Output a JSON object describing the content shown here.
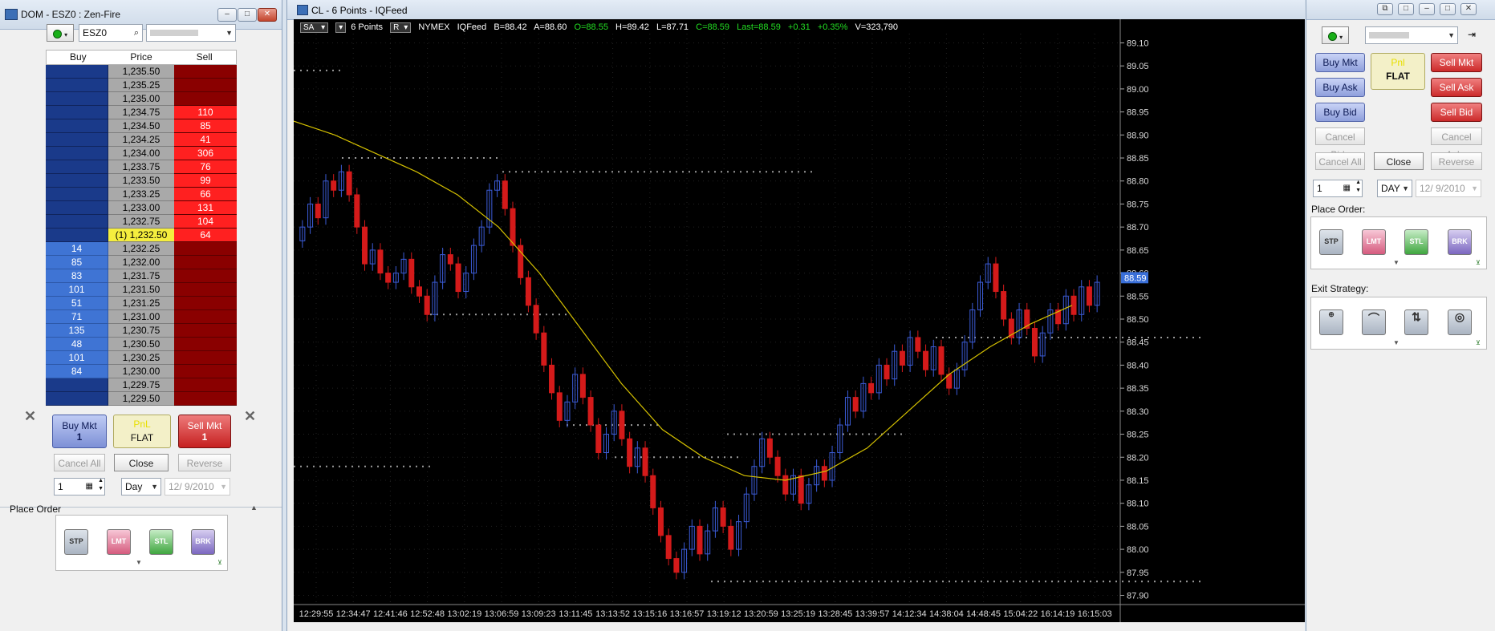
{
  "dom": {
    "title": "DOM - ESZ0 : Zen-Fire",
    "instrument": "ESZ0",
    "account": "",
    "headers": [
      "Buy",
      "Price",
      "Sell"
    ],
    "rows": [
      {
        "buy": "",
        "price": "1,235.50",
        "sell": ""
      },
      {
        "buy": "",
        "price": "1,235.25",
        "sell": ""
      },
      {
        "buy": "",
        "price": "1,235.00",
        "sell": ""
      },
      {
        "buy": "",
        "price": "1,234.75",
        "sell": "110"
      },
      {
        "buy": "",
        "price": "1,234.50",
        "sell": "85"
      },
      {
        "buy": "",
        "price": "1,234.25",
        "sell": "41"
      },
      {
        "buy": "",
        "price": "1,234.00",
        "sell": "306"
      },
      {
        "buy": "",
        "price": "1,233.75",
        "sell": "76"
      },
      {
        "buy": "",
        "price": "1,233.50",
        "sell": "99"
      },
      {
        "buy": "",
        "price": "1,233.25",
        "sell": "66"
      },
      {
        "buy": "",
        "price": "1,233.00",
        "sell": "131"
      },
      {
        "buy": "",
        "price": "1,232.75",
        "sell": "104"
      },
      {
        "buy": "",
        "price": "(1) 1,232.50",
        "sell": "64"
      },
      {
        "buy": "14",
        "price": "1,232.25",
        "sell": ""
      },
      {
        "buy": "85",
        "price": "1,232.00",
        "sell": ""
      },
      {
        "buy": "83",
        "price": "1,231.75",
        "sell": ""
      },
      {
        "buy": "101",
        "price": "1,231.50",
        "sell": ""
      },
      {
        "buy": "51",
        "price": "1,231.25",
        "sell": ""
      },
      {
        "buy": "71",
        "price": "1,231.00",
        "sell": ""
      },
      {
        "buy": "135",
        "price": "1,230.75",
        "sell": ""
      },
      {
        "buy": "48",
        "price": "1,230.50",
        "sell": ""
      },
      {
        "buy": "101",
        "price": "1,230.25",
        "sell": ""
      },
      {
        "buy": "84",
        "price": "1,230.00",
        "sell": ""
      },
      {
        "buy": "",
        "price": "1,229.75",
        "sell": ""
      },
      {
        "buy": "",
        "price": "1,229.50",
        "sell": ""
      }
    ],
    "buy_mkt": "Buy Mkt",
    "buy_qty": "1",
    "pnl_label": "PnL",
    "position": "FLAT",
    "sell_mkt": "Sell Mkt",
    "sell_qty": "1",
    "cancel_all": "Cancel All",
    "close": "Close",
    "reverse": "Reverse",
    "quantity": "1",
    "tif": "Day",
    "date": "12/ 9/2010",
    "place_order": "Place Order",
    "order_types": [
      "STP",
      "LMT",
      "STL",
      "BRK"
    ]
  },
  "chart": {
    "title": "CL - 6 Points - IQFeed",
    "mode": "SA",
    "period": "6 Points",
    "r_btn": "R",
    "exchange": "NYMEX",
    "feed": "IQFeed",
    "bid": "B=88.42",
    "ask": "A=88.60",
    "open": "O=88.55",
    "high": "H=89.42",
    "low": "L=87.71",
    "close": "C=88.59",
    "last": "Last=88.59",
    "change": "+0.31",
    "change_pct": "+0.35%",
    "volume": "V=323,790",
    "current_price_tag": "88.59"
  },
  "chart_data": {
    "type": "candlestick",
    "y_ticks": [
      "89.10",
      "89.05",
      "89.00",
      "88.95",
      "88.90",
      "88.85",
      "88.80",
      "88.75",
      "88.70",
      "88.65",
      "88.60",
      "88.55",
      "88.50",
      "88.45",
      "88.40",
      "88.35",
      "88.30",
      "88.25",
      "88.20",
      "88.15",
      "88.10",
      "88.05",
      "88.00",
      "87.95",
      "87.90"
    ],
    "ylim": [
      87.88,
      89.12
    ],
    "x_ticks": [
      "12:29:55",
      "12:34:47",
      "12:41:46",
      "12:52:48",
      "13:02:19",
      "13:06:59",
      "13:09:23",
      "13:11:45",
      "13:13:52",
      "13:15:16",
      "13:16:57",
      "13:19:12",
      "13:20:59",
      "13:25:19",
      "13:28:45",
      "13:39:57",
      "14:12:34",
      "14:38:04",
      "14:48:45",
      "15:04:22",
      "16:14:19",
      "16:15:03"
    ],
    "closes": [
      88.7,
      88.75,
      88.72,
      88.8,
      88.78,
      88.82,
      88.77,
      88.7,
      88.62,
      88.65,
      88.6,
      88.58,
      88.6,
      88.63,
      88.57,
      88.55,
      88.51,
      88.58,
      88.64,
      88.62,
      88.56,
      88.6,
      88.66,
      88.7,
      88.78,
      88.8,
      88.74,
      88.66,
      88.59,
      88.53,
      88.47,
      88.4,
      88.34,
      88.28,
      88.32,
      88.38,
      88.33,
      88.27,
      88.21,
      88.25,
      88.3,
      88.24,
      88.18,
      88.22,
      88.16,
      88.09,
      88.03,
      87.98,
      87.95,
      88.0,
      88.05,
      87.99,
      88.04,
      88.09,
      88.05,
      88.0,
      88.06,
      88.12,
      88.18,
      88.24,
      88.2,
      88.16,
      88.12,
      88.16,
      88.1,
      88.14,
      88.18,
      88.15,
      88.21,
      88.27,
      88.33,
      88.3,
      88.36,
      88.34,
      88.4,
      88.37,
      88.43,
      88.4,
      88.46,
      88.43,
      88.39,
      88.44,
      88.38,
      88.35,
      88.39,
      88.45,
      88.52,
      88.58,
      88.62,
      88.56,
      88.5,
      88.46,
      88.52,
      88.48,
      88.42,
      88.47,
      88.52,
      88.49,
      88.55,
      88.51,
      88.57,
      88.53,
      88.58
    ],
    "moving_average": [
      88.93,
      88.9,
      88.86,
      88.82,
      88.77,
      88.7,
      88.6,
      88.48,
      88.36,
      88.26,
      88.2,
      88.16,
      88.15,
      88.17,
      88.22,
      88.3,
      88.38,
      88.44,
      88.49,
      88.53
    ],
    "levels": [
      89.04,
      88.85,
      88.82,
      88.51,
      88.27,
      88.25,
      88.2,
      88.18,
      88.46,
      87.93
    ]
  },
  "side": {
    "buy_mkt": "Buy Mkt",
    "buy_ask": "Buy Ask",
    "buy_bid": "Buy Bid",
    "pnl_label": "Pnl",
    "position": "FLAT",
    "sell_mkt": "Sell Mkt",
    "sell_ask": "Sell Ask",
    "sell_bid": "Sell Bid",
    "cancel_bids": "Cancel Bids",
    "cancel_asks": "Cancel Asks",
    "cancel_all": "Cancel All",
    "close": "Close",
    "reverse": "Reverse",
    "quantity": "1",
    "tif": "DAY",
    "date": "12/ 9/2010",
    "place_order": "Place Order:",
    "exit_strategy": "Exit Strategy:",
    "order_types": [
      "STP",
      "LMT",
      "STL",
      "BRK"
    ]
  },
  "colors": {
    "candle_up": "#3b5bd6",
    "candle_down": "#d41a1a",
    "ma_line": "#d4c000",
    "bid_blue": "#1a3a8a",
    "ask_red": "#8a0000"
  }
}
